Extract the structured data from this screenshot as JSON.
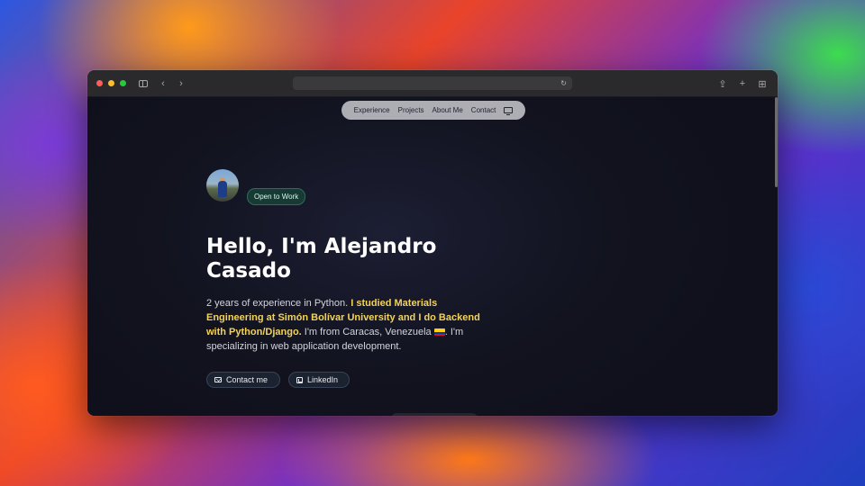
{
  "browser": {
    "address_text": "",
    "icons": {
      "sidebar": "sidebar-icon",
      "back": "chevron-left-icon",
      "forward": "chevron-right-icon",
      "reload": "reload-icon",
      "share": "share-icon",
      "new_tab": "plus-icon",
      "tabs": "grid-icon"
    },
    "back_glyph": "‹",
    "forward_glyph": "›",
    "reload_glyph": "↻",
    "share_glyph": "⇪",
    "new_tab_glyph": "+",
    "tabs_glyph": "⊞"
  },
  "nav": {
    "items": [
      {
        "label": "Experience"
      },
      {
        "label": "Projects"
      },
      {
        "label": "About Me"
      },
      {
        "label": "Contact"
      }
    ],
    "theme_icon": "monitor-icon"
  },
  "hero": {
    "status_badge": "Open to Work",
    "heading": "Hello, I'm Alejandro Casado",
    "intro": {
      "part1": "2 years of experience in Python. ",
      "highlight": "I studied Materials Engineering at Simón Bolívar University and I do Backend with Python/Django.",
      "part2": " I'm from Caracas, Venezuela ",
      "part3": ". I'm specializing in web application development."
    },
    "buttons": {
      "contact_label": "Contact me",
      "linkedin_label": "LinkedIn"
    }
  },
  "colors": {
    "accent_highlight": "#f3d35a",
    "badge_bg": "#173a35",
    "page_bg": "#11121e"
  }
}
